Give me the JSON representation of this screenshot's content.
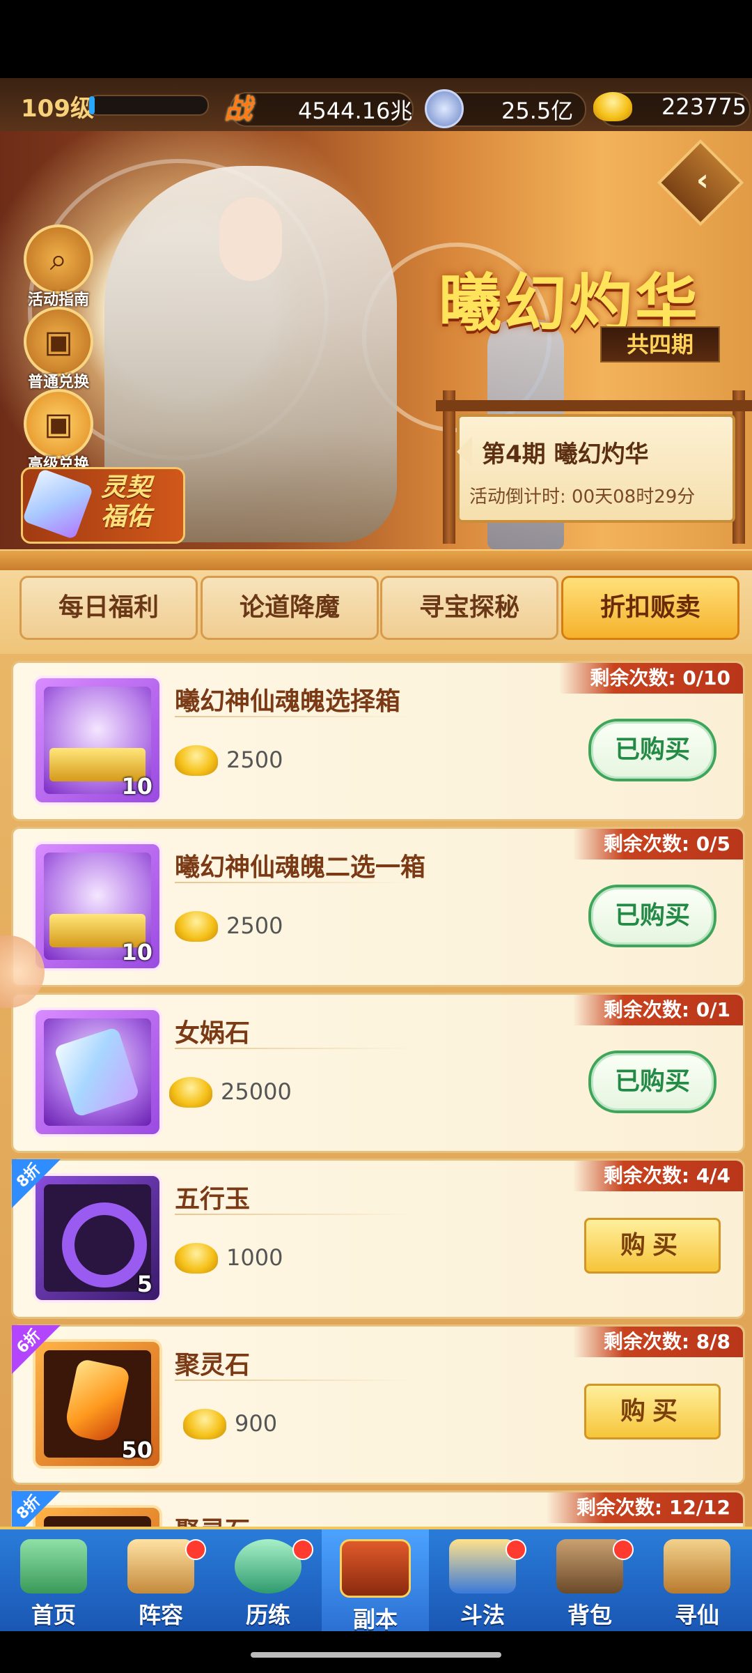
{
  "resources": {
    "level": "109级",
    "power_icon_label": "战",
    "power": "4544.16兆",
    "silver": "25.5亿",
    "gold": "223775"
  },
  "banner": {
    "title": "曦幻灼华",
    "periods": "共四期",
    "side_buttons": [
      {
        "label": "活动指南",
        "icon": "magnifier-icon"
      },
      {
        "label": "普通兑换",
        "icon": "giftbox-icon"
      },
      {
        "label": "高级兑换",
        "icon": "giftbox-icon"
      }
    ],
    "bless_label": "灵契福佑",
    "period_name": "第4期  曦幻灼华",
    "countdown": "活动倒计时: 00天08时29分"
  },
  "tabs": [
    "每日福利",
    "论道降魔",
    "寻宝探秘",
    "折扣贩卖"
  ],
  "active_tab": 3,
  "items": [
    {
      "name": "曦幻神仙魂魄选择箱",
      "price": "2500",
      "qty": "10",
      "remaining": "剩余次数: 0/10",
      "button": "已购买",
      "bought": true,
      "discount": ""
    },
    {
      "name": "曦幻神仙魂魄二选一箱",
      "price": "2500",
      "qty": "10",
      "remaining": "剩余次数: 0/5",
      "button": "已购买",
      "bought": true,
      "discount": ""
    },
    {
      "name": "女娲石",
      "price": "25000",
      "qty": "",
      "remaining": "剩余次数: 0/1",
      "button": "已购买",
      "bought": true,
      "discount": ""
    },
    {
      "name": "五行玉",
      "price": "1000",
      "qty": "5",
      "remaining": "剩余次数: 4/4",
      "button": "购买",
      "bought": false,
      "discount": "8折"
    },
    {
      "name": "聚灵石",
      "price": "900",
      "qty": "50",
      "remaining": "剩余次数: 8/8",
      "button": "购买",
      "bought": false,
      "discount": "6折"
    },
    {
      "name": "聚灵石",
      "price": "",
      "qty": "",
      "remaining": "剩余次数: 12/12",
      "button": "",
      "bought": false,
      "discount": "8折"
    }
  ],
  "nav": [
    {
      "label": "首页",
      "icon": "home-mountain-icon",
      "badge": false
    },
    {
      "label": "阵容",
      "icon": "cards-icon",
      "badge": true
    },
    {
      "label": "历练",
      "icon": "tortoise-icon",
      "badge": true
    },
    {
      "label": "副本",
      "icon": "gate-icon",
      "badge": false,
      "active": true
    },
    {
      "label": "斗法",
      "icon": "crest-icon",
      "badge": true
    },
    {
      "label": "背包",
      "icon": "bag-icon",
      "badge": true
    },
    {
      "label": "寻仙",
      "icon": "scroll-icon",
      "badge": false
    }
  ],
  "colors": {
    "accent_gold": "#f5b22c",
    "bought_green": "#3fa55a",
    "remaining_red": "#c8421e",
    "nav_blue": "#1a56b3"
  }
}
